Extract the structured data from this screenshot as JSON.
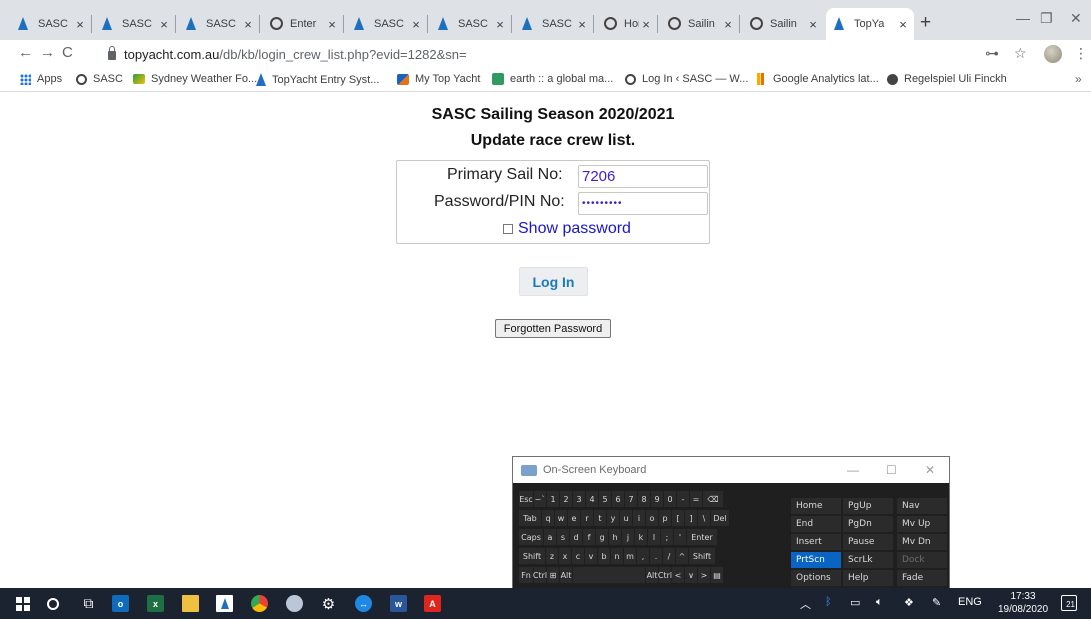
{
  "browser": {
    "tabs": [
      {
        "label": "SASC",
        "icon": "yacht-icon"
      },
      {
        "label": "SASC",
        "icon": "yacht-icon"
      },
      {
        "label": "SASC",
        "icon": "yacht-icon"
      },
      {
        "label": "Enter",
        "icon": "ring-icon"
      },
      {
        "label": "SASC",
        "icon": "yacht-icon"
      },
      {
        "label": "SASC",
        "icon": "yacht-icon"
      },
      {
        "label": "SASC",
        "icon": "yacht-icon"
      },
      {
        "label": "Home",
        "icon": "ring-icon"
      },
      {
        "label": "Sailin",
        "icon": "ring-icon"
      },
      {
        "label": "Sailin",
        "icon": "ring-icon"
      },
      {
        "label": "TopYa",
        "icon": "yacht-icon",
        "active": true
      }
    ],
    "url_host": "topyacht.com.au",
    "url_path": "/db/kb/login_crew_list.php?evid=1282&sn=",
    "bookmarks": [
      {
        "label": "Apps"
      },
      {
        "label": "SASC"
      },
      {
        "label": "Sydney Weather Fo..."
      },
      {
        "label": "TopYacht Entry Syst..."
      },
      {
        "label": "My Top Yacht"
      },
      {
        "label": "earth :: a global ma..."
      },
      {
        "label": "Log In ‹ SASC — W..."
      },
      {
        "label": "Google Analytics lat..."
      },
      {
        "label": "Regelspiel Uli Finckh"
      }
    ]
  },
  "page": {
    "title": "SASC Sailing Season 2020/2021",
    "subtitle": "Update race crew list.",
    "sail_label": "Primary Sail No:",
    "sail_value": "7206",
    "password_label": "Password/PIN No:",
    "password_mask": "•••••••••",
    "show_password_label": "Show password",
    "login_label": "Log In",
    "forgot_label": "Forgotten Password"
  },
  "osk": {
    "title": "On-Screen Keyboard",
    "row1": [
      "Esc",
      "~`",
      "1",
      "2",
      "3",
      "4",
      "5",
      "6",
      "7",
      "8",
      "9",
      "0",
      "-",
      "=",
      "⌫"
    ],
    "row2": [
      "Tab",
      "q",
      "w",
      "e",
      "r",
      "t",
      "y",
      "u",
      "i",
      "o",
      "p",
      "[",
      "]",
      "\\",
      "Del"
    ],
    "row3": [
      "Caps",
      "a",
      "s",
      "d",
      "f",
      "g",
      "h",
      "j",
      "k",
      "l",
      ";",
      "'",
      "Enter"
    ],
    "row4": [
      "Shift",
      "z",
      "x",
      "c",
      "v",
      "b",
      "n",
      "m",
      ",",
      ".",
      "/",
      "^",
      "Shift"
    ],
    "row5": [
      "Fn",
      "Ctrl",
      "⊞",
      "Alt",
      "",
      "Alt",
      "Ctrl",
      "<",
      "∨",
      ">",
      "▤"
    ],
    "nav": [
      "Home",
      "PgUp",
      "Nav",
      "End",
      "PgDn",
      "Mv Up",
      "Insert",
      "Pause",
      "Mv Dn",
      "PrtScn",
      "ScrLk",
      "Dock",
      "Options",
      "Help",
      "Fade"
    ]
  },
  "taskbar": {
    "language": "ENG",
    "time": "17:33",
    "date": "19/08/2020",
    "notifications": "21"
  }
}
